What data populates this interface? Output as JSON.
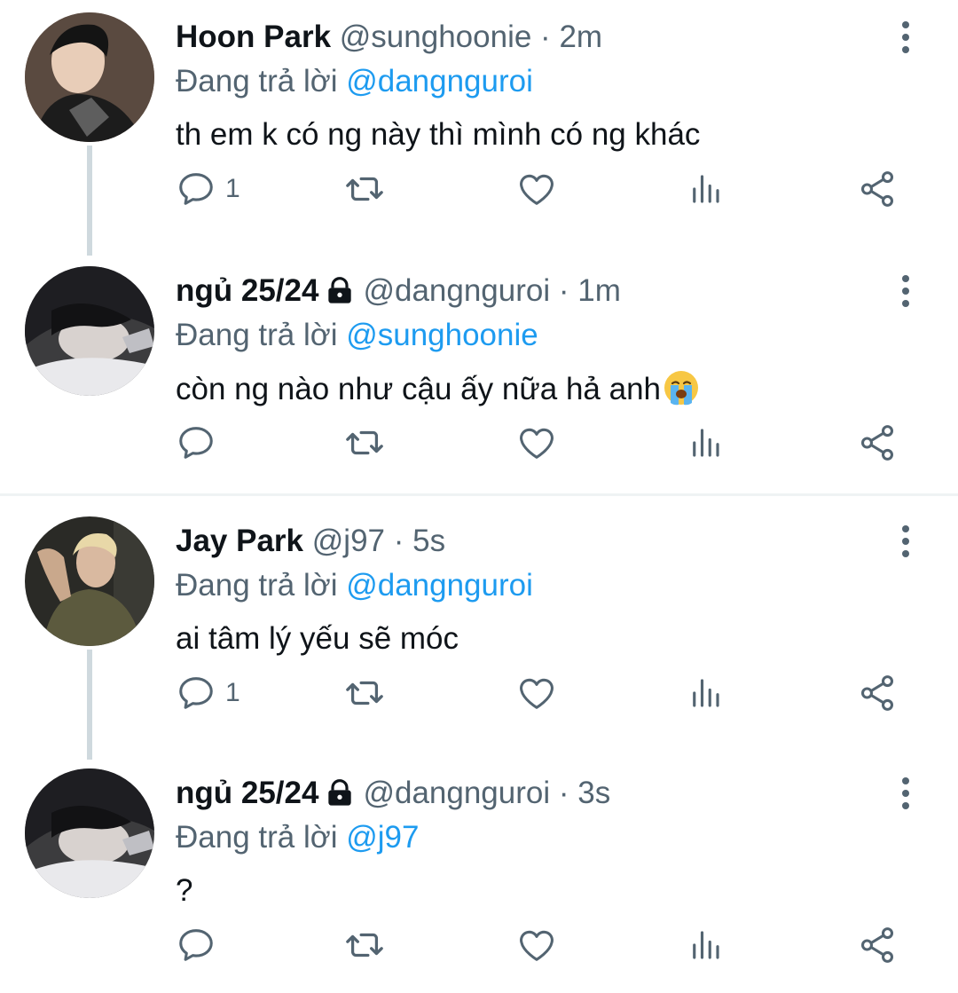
{
  "reply_prefix": "Đang trả lời",
  "tweets": [
    {
      "name": "Hoon Park",
      "handle": "@sunghoonie",
      "dot": "·",
      "time": "2m",
      "locked": false,
      "reply_to": "@dangnguroi",
      "text": "th em k có ng này thì mình có ng khác",
      "reply_count": "1",
      "avatar": "young man with dark hair, black hoodie"
    },
    {
      "name": "ngủ 25/24",
      "handle": "@dangnguroi",
      "dot": "·",
      "time": "1m",
      "locked": true,
      "reply_to": "@sunghoonie",
      "text": "còn ng nào như cậu ấy nữa hả anh",
      "emoji": "loudly-crying-face",
      "reply_count": "",
      "avatar": "person lying on white pillow, dark hair"
    },
    {
      "name": "Jay Park",
      "handle": "@j97",
      "dot": "·",
      "time": "5s",
      "locked": false,
      "reply_to": "@dangnguroi",
      "text": "ai tâm lý yếu sẽ móc",
      "reply_count": "1",
      "avatar": "blond man in olive jacket"
    },
    {
      "name": "ngủ 25/24",
      "handle": "@dangnguroi",
      "dot": "·",
      "time": "3s",
      "locked": true,
      "reply_to": "@j97",
      "text": "?",
      "reply_count": "",
      "avatar": "person lying on white pillow, dark hair"
    }
  ],
  "colors": {
    "text": "#0f1419",
    "secondary": "#536471",
    "link": "#1d9bf0",
    "thread_line": "#cfd9de",
    "divider": "#eff3f4"
  },
  "icons": [
    "reply-icon",
    "retweet-icon",
    "like-icon",
    "views-icon",
    "share-icon",
    "more-icon",
    "lock-icon"
  ]
}
